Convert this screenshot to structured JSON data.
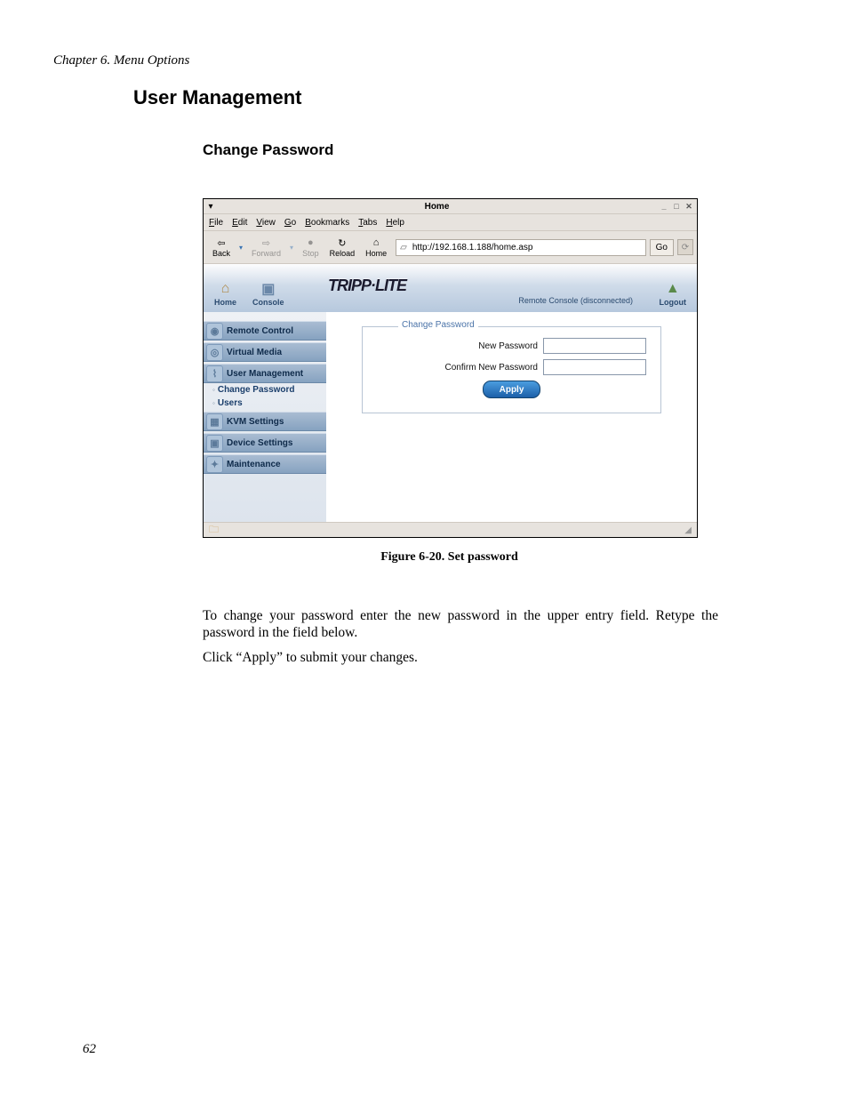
{
  "page": {
    "chapter_line": "Chapter 6. Menu Options",
    "heading1": "User Management",
    "heading2": "Change Password",
    "figure_caption": "Figure 6-20. Set password",
    "para1": "To change your password enter the new password in the upper entry field. Retype the password in the field below.",
    "para2": "Click “Apply” to submit your changes.",
    "page_number": "62"
  },
  "browser": {
    "title": "Home",
    "menubar": [
      "File",
      "Edit",
      "View",
      "Go",
      "Bookmarks",
      "Tabs",
      "Help"
    ],
    "toolbar": {
      "back": "Back",
      "forward": "Forward",
      "stop": "Stop",
      "reload": "Reload",
      "home": "Home",
      "go": "Go",
      "address": "http://192.168.1.188/home.asp"
    }
  },
  "app": {
    "brand": "TRIPP·LITE",
    "home": "Home",
    "console": "Console",
    "logout": "Logout",
    "status": "Remote Console (disconnected)",
    "nav": {
      "items": [
        "Remote Control",
        "Virtual Media",
        "User Management",
        "KVM Settings",
        "Device Settings",
        "Maintenance"
      ],
      "sub": {
        "change_password": "Change Password",
        "users": "Users"
      }
    },
    "form": {
      "legend": "Change Password",
      "new_password_label": "New Password",
      "confirm_label": "Confirm New Password",
      "apply": "Apply"
    }
  }
}
